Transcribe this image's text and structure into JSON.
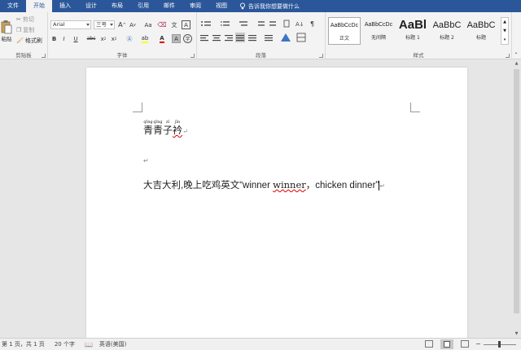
{
  "tabs": {
    "file": "文件",
    "home": "开始",
    "insert": "插入",
    "design": "设计",
    "layout": "布局",
    "references": "引用",
    "mailings": "邮件",
    "review": "审阅",
    "view": "视图",
    "tellme": "告诉我你想要做什么"
  },
  "clipboard": {
    "paste": "粘贴",
    "cut": "剪切",
    "copy": "复制",
    "format_painter": "格式刷",
    "label": "剪贴板"
  },
  "font": {
    "name": "Arial",
    "size": "三号",
    "grow": "A",
    "shrink": "A",
    "case": "Aa",
    "bold": "B",
    "italic": "I",
    "underline": "U",
    "strike": "abc",
    "sub": "x",
    "sup": "x",
    "color_a": "A",
    "label": "字体"
  },
  "paragraph": {
    "label": "段落"
  },
  "styles": {
    "items": [
      {
        "sample": "AaBbCcDc",
        "name": "正文"
      },
      {
        "sample": "AaBbCcDc",
        "name": "无间隔"
      },
      {
        "sample": "AaBl",
        "name": "标题 1"
      },
      {
        "sample": "AaBbC",
        "name": "标题 2"
      },
      {
        "sample": "AaBbC",
        "name": "标题"
      }
    ],
    "label": "样式"
  },
  "doc": {
    "line1_ruby": [
      {
        "base": "青",
        "rt": "qīng"
      },
      {
        "base": "青",
        "rt": "qīng"
      },
      {
        "base": "子",
        "rt": "zǐ"
      },
      {
        "base": "衿",
        "rt": "jīn"
      }
    ],
    "para_mark": "↵",
    "line3_a": "大吉大利,晚上吃鸡英文“winner ",
    "line3_b": "winner",
    "line3_c": "，chicken dinner”"
  },
  "status": {
    "page": "第 1 页，共 1 页",
    "words": "20 个字",
    "lang": "英语(美国)"
  },
  "colors": {
    "brand": "#2b579a",
    "highlight": "#ffff00",
    "font_color": "#e00000"
  }
}
